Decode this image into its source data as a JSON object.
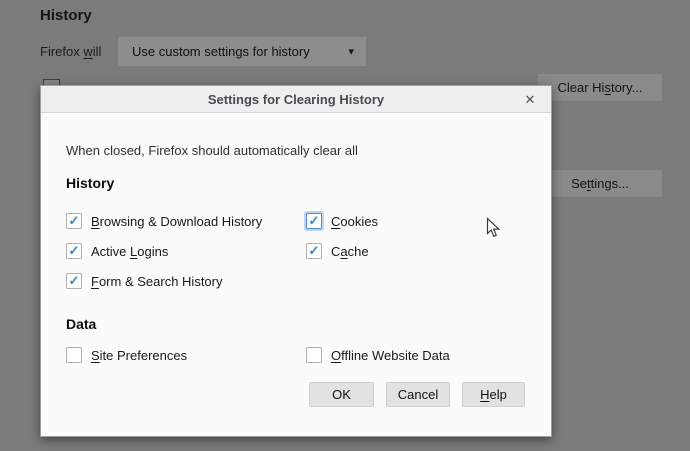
{
  "icons": {
    "close": "✕",
    "dropdown_arrow": "▾",
    "check": "✓"
  },
  "background": {
    "section_title": "History",
    "firefox_will": {
      "pre": "Firefox ",
      "key": "w",
      "post": "ill"
    },
    "history_dropdown": {
      "value": "Use custom settings for history"
    },
    "clear_history_button": {
      "pre": "Clear Hi",
      "key": "s",
      "post": "tory..."
    },
    "settings_button": {
      "pre": "Se",
      "key": "t",
      "post": "tings..."
    }
  },
  "dialog": {
    "title": "Settings for Clearing History",
    "description": "When closed, Firefox should automatically clear all",
    "history_section": {
      "title": "History",
      "items": [
        {
          "pre": "",
          "key": "B",
          "post": "rowsing & Download History",
          "checked": true,
          "focused": false
        },
        {
          "pre": "",
          "key": "C",
          "post": "ookies",
          "checked": true,
          "focused": true
        },
        {
          "pre": "Active ",
          "key": "L",
          "post": "ogins",
          "checked": true,
          "focused": false
        },
        {
          "pre": "C",
          "key": "a",
          "post": "che",
          "checked": true,
          "focused": false
        },
        {
          "pre": "",
          "key": "F",
          "post": "orm & Search History",
          "checked": true,
          "focused": false
        }
      ]
    },
    "data_section": {
      "title": "Data",
      "items": [
        {
          "pre": "",
          "key": "S",
          "post": "ite Preferences",
          "checked": false
        },
        {
          "pre": "",
          "key": "O",
          "post": "ffline Website Data",
          "checked": false
        }
      ]
    },
    "buttons": {
      "ok": "OK",
      "cancel": "Cancel",
      "help": {
        "pre": "",
        "key": "H",
        "post": "elp"
      }
    }
  },
  "colors": {
    "dim_background": "#7b7b7b",
    "dialog_body": "#fbfbfb",
    "dialog_header": "#efefef",
    "checkbox_check": "#2b87d0",
    "focus_ring": "#4a90d9",
    "button_face": "#e2e2e2"
  }
}
